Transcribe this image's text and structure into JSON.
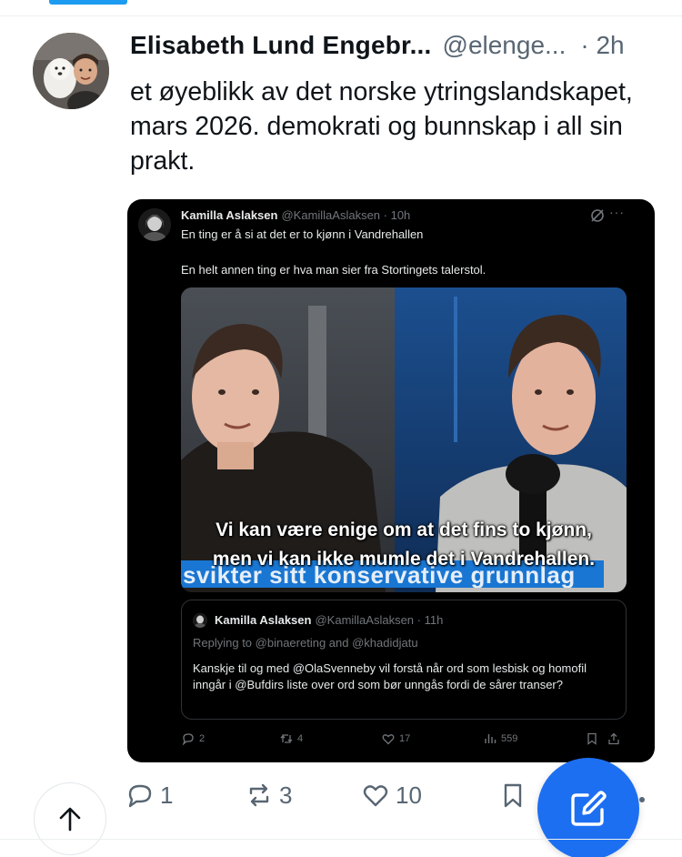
{
  "post": {
    "author_name": "Elisabeth Lund Engebr...",
    "author_handle": "@elenge...",
    "time": "· 2h",
    "text": "et øyeblikk av det norske ytringslandskapet, mars 2026. demokrati og bunnskap i all sin prakt."
  },
  "embed": {
    "author_name": "Kamilla Aslaksen",
    "author_handle": "@KamillaAslaksen · 10h",
    "line1": "En ting er å si at det er to kjønn i Vandrehallen",
    "line2": "En helt annen ting er hva man sier fra Stortingets talerstol.",
    "more": "···",
    "video": {
      "caption_line1": "Vi kan være enige om at det fins to kjønn,",
      "caption_line2": "men vi kan ikke mumle det i Vandrehallen.",
      "lower_third": "svikter sitt konservative grunnlag"
    },
    "quote": {
      "author_name": "Kamilla Aslaksen",
      "author_handle": "@KamillaAslaksen · 11h",
      "replying_to": "Replying to @binaereting and @khadidjatu",
      "text": "Kanskje til og med @OlaSvenneby vil forstå når ord som lesbisk og homofil inngår i @Bufdirs liste over ord som bør unngås fordi de sårer transer?"
    },
    "actions": {
      "replies": "2",
      "reposts": "4",
      "likes": "17",
      "views": "559"
    }
  },
  "actions": {
    "replies": "1",
    "reposts": "3",
    "likes": "10"
  },
  "colors": {
    "accent": "#1d9bf0",
    "fab": "#1d6ff2",
    "muted": "#586673"
  }
}
